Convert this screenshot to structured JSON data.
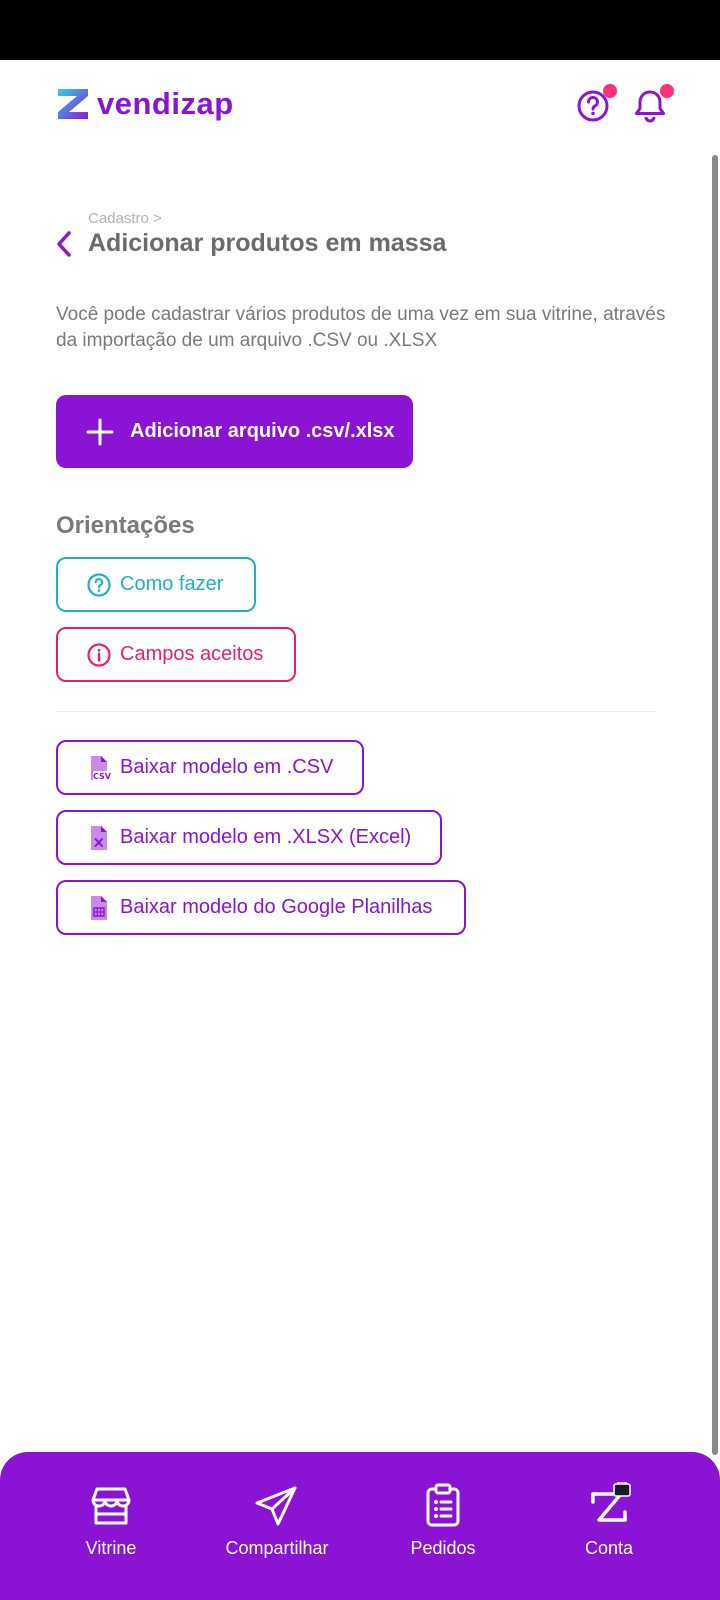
{
  "brand": {
    "name": "vendizap",
    "color": "#8a13d4"
  },
  "header": {
    "help_icon": "help-circle-icon",
    "notification_icon": "bell-icon",
    "badge_color": "#ff2f7d"
  },
  "breadcrumb": {
    "parent": "Cadastro >",
    "title": "Adicionar produtos em massa"
  },
  "intro_text": "Você pode cadastrar vários produtos de uma vez em sua vitrine, através da importação de um arquivo .CSV ou .XLSX",
  "primary_action": {
    "label": "Adicionar arquivo .csv/.xlsx",
    "icon": "plus-icon"
  },
  "guidance": {
    "title": "Orientações",
    "how_to": {
      "label": "Como fazer",
      "icon": "help-circle-icon",
      "color": "#1bb3c4"
    },
    "accepted_fields": {
      "label": "Campos aceitos",
      "icon": "info-icon",
      "color": "#e51e78"
    }
  },
  "downloads": [
    {
      "label": "Baixar modelo em .CSV",
      "icon": "csv-file-icon"
    },
    {
      "label": "Baixar modelo em .XLSX (Excel)",
      "icon": "xlsx-file-icon"
    },
    {
      "label": "Baixar modelo do Google Planilhas",
      "icon": "spreadsheet-file-icon"
    }
  ],
  "bottom_nav": [
    {
      "label": "Vitrine",
      "icon": "storefront-icon"
    },
    {
      "label": "Compartilhar",
      "icon": "paper-plane-icon"
    },
    {
      "label": "Pedidos",
      "icon": "clipboard-list-icon"
    },
    {
      "label": "Conta",
      "icon": "account-z-icon"
    }
  ]
}
